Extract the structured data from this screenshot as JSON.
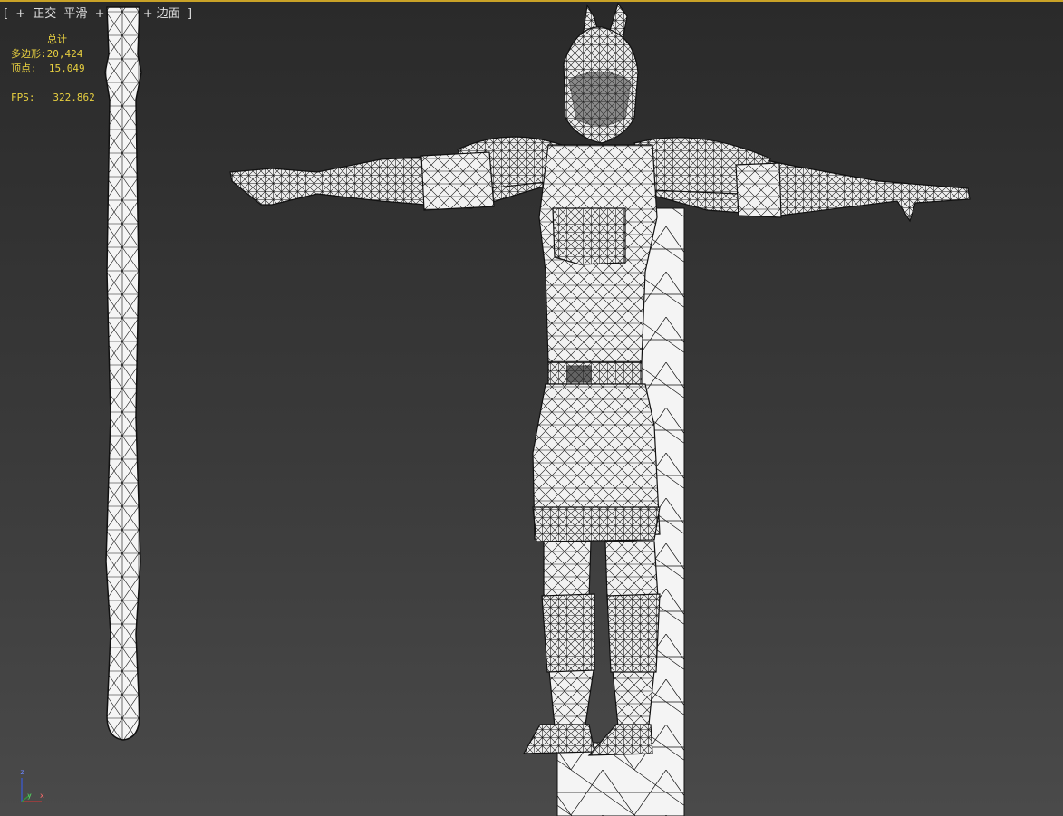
{
  "viewport": {
    "label_open": "[",
    "plus": "+",
    "view": "正交",
    "shading": "平滑",
    "plus2": "+",
    "highlight": "高光",
    "edged": "+ 边面",
    "label_close": "]"
  },
  "stats": {
    "title": "总计",
    "polygons_label": "多边形:",
    "polygons_value": "20,424",
    "vertices_label": "顶点:",
    "vertices_value": "15,049",
    "fps_label": "FPS:",
    "fps_value": "322.862"
  },
  "axis": {
    "z": "z",
    "x": "x",
    "y": "y"
  },
  "colors": {
    "accent_border": "#c9a227",
    "stats_text": "#e8d040",
    "wire": "#111111",
    "mesh_fill": "#f2f2f2"
  },
  "icons": [
    "staff-mesh",
    "character-mesh",
    "plane-mesh",
    "axis-gizmo-icon"
  ]
}
